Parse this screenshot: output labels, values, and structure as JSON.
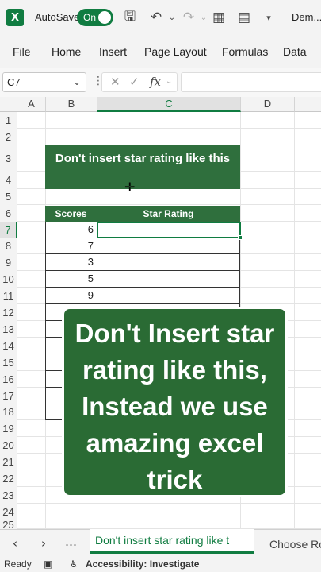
{
  "titlebar": {
    "logo": "X",
    "autosave_label": "AutoSave",
    "toggle_label": "On",
    "filename": "Dem..."
  },
  "ribbon": {
    "tabs": [
      "File",
      "Home",
      "Insert",
      "Page Layout",
      "Formulas",
      "Data"
    ]
  },
  "formula_bar": {
    "name_box": "C7",
    "fx": "fx",
    "value": ""
  },
  "columns": [
    "A",
    "B",
    "C",
    "D"
  ],
  "rows": [
    "1",
    "2",
    "3",
    "4",
    "5",
    "6",
    "7",
    "8",
    "9",
    "10",
    "11",
    "12",
    "13",
    "14",
    "15",
    "16",
    "17",
    "18",
    "19",
    "20",
    "21",
    "22",
    "23",
    "24",
    "25"
  ],
  "sheet": {
    "title": "Don't insert star rating like this",
    "header_scores": "Scores",
    "header_star": "Star Rating",
    "scores": [
      "6",
      "7",
      "3",
      "5",
      "9"
    ]
  },
  "caption": "Don't Insert star rating like this, Instead we use amazing excel trick",
  "tabs": {
    "active": "Don't insert star rating like t",
    "other": "Choose Ro"
  },
  "status": {
    "ready": "Ready",
    "accessibility": "Accessibility: Investigate"
  },
  "colors": {
    "excel_green": "#107c41",
    "header_fill": "#2f6f3d",
    "caption_fill": "#2a6b34"
  }
}
